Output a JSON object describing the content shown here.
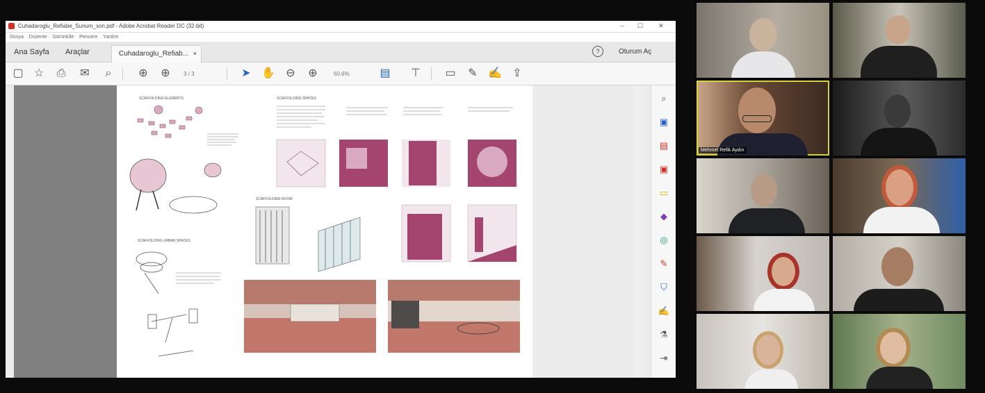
{
  "window": {
    "doc_title": "Cuhadaroglu_Refiabe_Sunum_son.pdf - Adobe Acrobat Reader DC (32-bit)",
    "controls": [
      "–",
      "☐",
      "✕"
    ]
  },
  "menu": {
    "items": [
      "Dosya",
      "Düzenle",
      "Görüntüle",
      "Pencere",
      "Yardım"
    ]
  },
  "tabs": {
    "home": "Ana Sayfa",
    "tools": "Araçlar",
    "document": "Cuhadaroglu_Refiab...",
    "close": "×",
    "help": "?",
    "signin": "Oturum Aç"
  },
  "toolbar": {
    "page_display": "3 / 3",
    "zoom": "60.6%"
  },
  "pdf": {
    "sections": [
      "SCAFFOLDING ELEMENTS",
      "SCAFFOLDING SPACES",
      "SCAFFOLDING ROOM",
      "SCAFFOLDING URBAN SPACES"
    ]
  },
  "colors": {
    "accent": "#a3456f",
    "accent_light": "#d9a9c0",
    "active_speaker": "#d6d23a"
  },
  "participants": [
    {
      "name": "",
      "icon": "participant-video"
    },
    {
      "name": "",
      "icon": "participant-video"
    },
    {
      "name": "Mehmet Refik Aydın",
      "icon": "participant-video",
      "active": true
    },
    {
      "name": "",
      "icon": "participant-video"
    },
    {
      "name": "",
      "icon": "participant-video"
    },
    {
      "name": "",
      "icon": "participant-video"
    },
    {
      "name": "",
      "icon": "participant-video"
    },
    {
      "name": "",
      "icon": "participant-video"
    },
    {
      "name": "",
      "icon": "participant-video"
    },
    {
      "name": "",
      "icon": "participant-video"
    }
  ]
}
